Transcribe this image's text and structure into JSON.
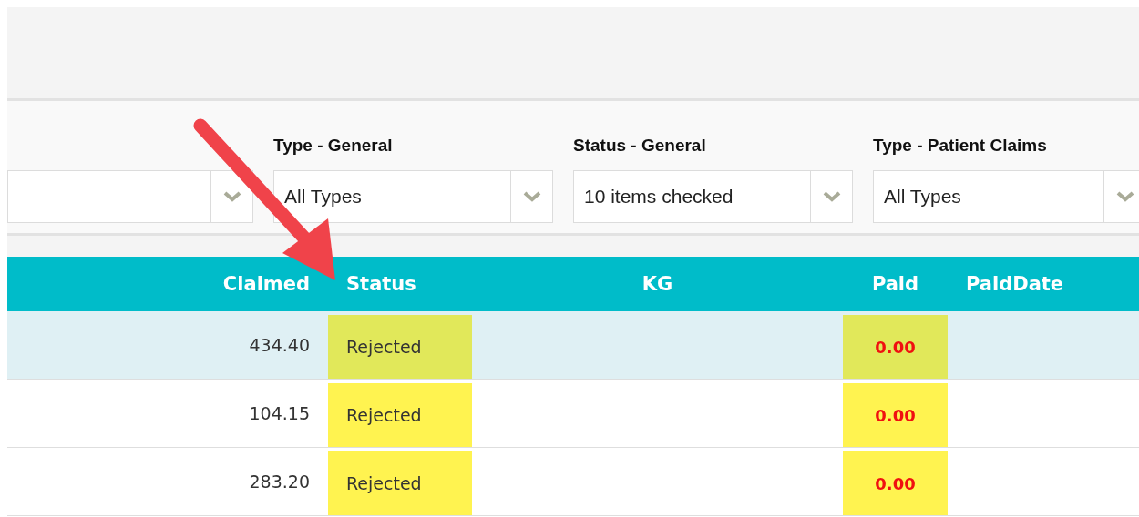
{
  "filters": [
    {
      "kind": "select"
    },
    {
      "kind": "select",
      "label": "Type - General",
      "value": "All Types"
    },
    {
      "kind": "select",
      "label": "Status - General",
      "value": "10 items checked"
    },
    {
      "kind": "select",
      "label": "Type - Patient Claims",
      "value": "All Types"
    }
  ],
  "table": {
    "columns": [
      "Claimed",
      "Status",
      "KG",
      "Paid",
      "PaidDate"
    ],
    "rows": [
      {
        "selected": true,
        "cells": [
          {
            "text": "434.40",
            "highlighted": false
          },
          {
            "text": "Rejected",
            "highlighted": true
          },
          {
            "highlighted": false
          },
          {
            "text": "0.00",
            "highlighted": true
          },
          {
            "highlighted": false
          }
        ]
      },
      {
        "selected": false,
        "cells": [
          {
            "text": "104.15",
            "highlighted": false
          },
          {
            "text": "Rejected",
            "highlighted": true
          },
          {
            "highlighted": false
          },
          {
            "text": "0.00",
            "highlighted": true
          },
          {
            "highlighted": false
          }
        ]
      },
      {
        "selected": false,
        "cells": [
          {
            "text": "283.20",
            "highlighted": false
          },
          {
            "text": "Rejected",
            "highlighted": true
          },
          {
            "highlighted": false
          },
          {
            "text": "0.00",
            "highlighted": true
          },
          {
            "highlighted": false
          }
        ]
      }
    ]
  }
}
